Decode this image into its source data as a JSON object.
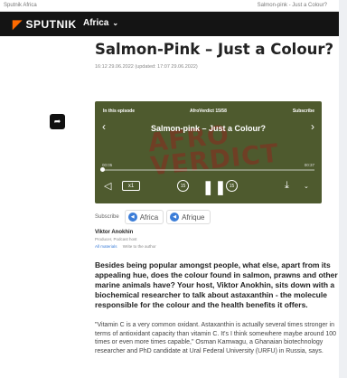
{
  "topstrip": {
    "left_text": "Sputnik Africa",
    "right_text": "Salmon-pink - Just a Colour?"
  },
  "header": {
    "logo_text": "SPUTNIK",
    "logo_mark": "◤",
    "region": "Africa",
    "region_chevron": "⌄"
  },
  "share_icon_glyph": "➦",
  "article": {
    "title": "Salmon-Pink – Just a Colour?",
    "dates": "16:12 29.06.2022 (updated: 17:07 29.06.2022)"
  },
  "player": {
    "label_left": "In this episode",
    "label_mid": "AfroVerdict 15/58",
    "label_right": "Subscribe",
    "background_text_line1": "AFRO",
    "background_text_line2": "VERDICT",
    "episode_title": "Salmon-pink – Just a Colour?",
    "prev_glyph": "‹",
    "next_glyph": "›",
    "time_start": "00:05",
    "time_end": "00:37",
    "progress_fraction": 0.0,
    "volume_glyph": "◁",
    "speed_label": "x1",
    "skip_back_label": "15",
    "pause_glyph": "❚❚",
    "skip_forward_label": "15",
    "download_glyph": "⤓",
    "more_glyph": "⌄"
  },
  "subscribe": {
    "label": "Subscribe",
    "options": [
      {
        "label": "Africa",
        "icon_glyph": "◀"
      },
      {
        "label": "Afrique",
        "icon_glyph": "◀"
      }
    ]
  },
  "author": {
    "name": "Viktor Anokhin",
    "role": "Producer, Podcast host",
    "link_materials": "All materials",
    "link_write": "Write to the author"
  },
  "lead_paragraph": "Besides being popular amongst people, what else, apart from its appealing hue, does the colour found in salmon, prawns and other marine animals have? Your host, Viktor Anokhin, sits down with a biochemical researcher to talk about astaxanthin - the molecule responsible for the colour and the health benefits it offers.",
  "body_paragraph": "\"Vitamin C is a very common oxidant. Astaxanthin is actually several times stronger in terms of antioxidant capacity than vitamin C. It's I think somewhere maybe around 100 times or even more times capable,\" Osman Kamwagu, a Ghanaian biotechnology researcher and PhD candidate at Ural Federal University (URFU) in Russia, says.",
  "colors": {
    "header_bg": "#141414",
    "logo_accent": "#ff6a00",
    "player_bg": "#4e5a2e",
    "link_blue": "#3b7dd8"
  }
}
